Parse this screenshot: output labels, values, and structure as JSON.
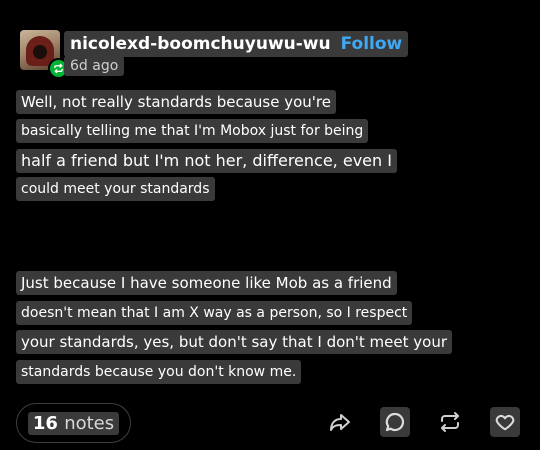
{
  "post": {
    "author": "nicolexd-boomchuyuwu-wu",
    "follow_label": "Follow",
    "time_ago": "6d ago",
    "lines": [
      "Well, not really standards because you're",
      "basically telling me that I'm Mobox just for being",
      "half a friend but I'm not her, difference, even I",
      "could meet your standards",
      "Just because I have someone like Mob as a friend",
      "doesn't mean that I am X way as a person, so I respect",
      "your standards, yes, but don't say that I don't meet your",
      "standards because you don't know me."
    ],
    "notes_count": "16",
    "notes_label": "notes"
  },
  "icons": {
    "share": "share-icon",
    "reply": "reply-icon",
    "reblog": "reblog-icon",
    "like": "heart-icon",
    "badge": "reblog-badge-icon"
  },
  "colors": {
    "background": "#000000",
    "highlight": "#3a3a3a",
    "follow": "#3fa9f5",
    "reblog_badge": "#00b331"
  }
}
